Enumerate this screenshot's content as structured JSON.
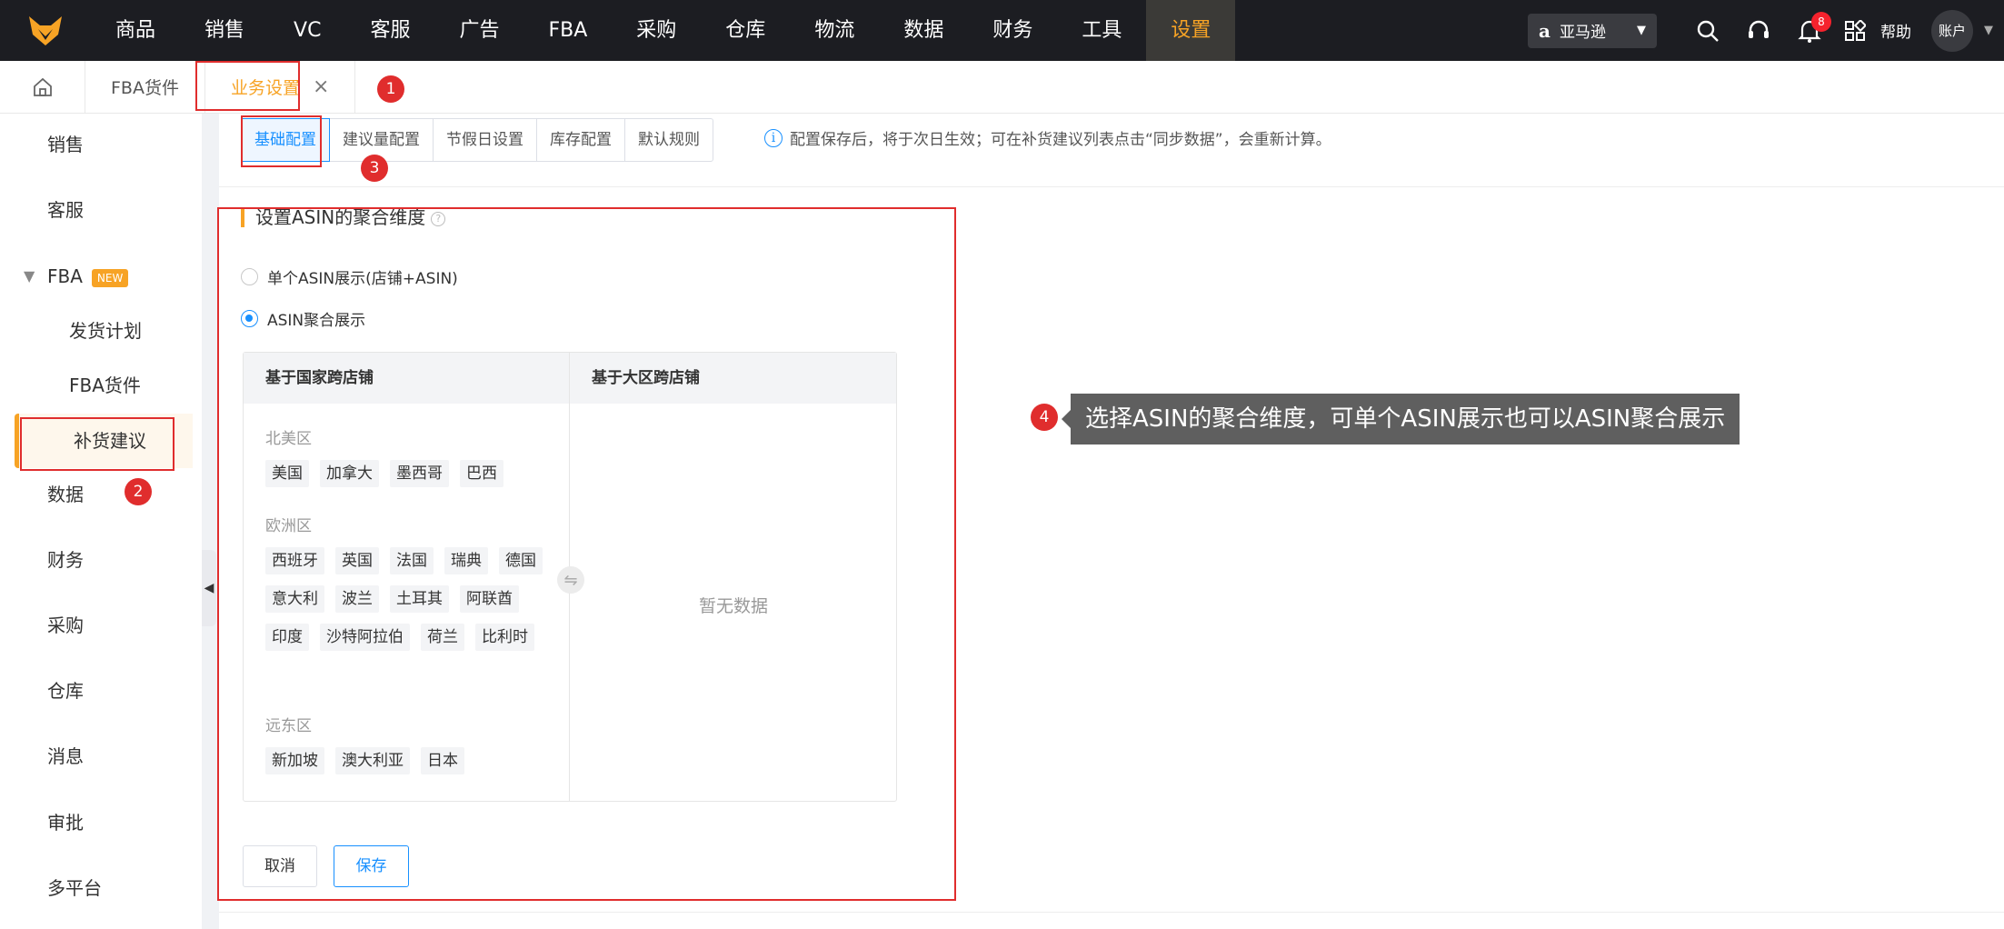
{
  "topnav": {
    "items": [
      "商品",
      "销售",
      "VC",
      "客服",
      "广告",
      "FBA",
      "采购",
      "仓库",
      "物流",
      "数据",
      "财务",
      "工具",
      "设置"
    ],
    "active_index": 12,
    "marketplace": "亚马逊",
    "notification_count": "8",
    "help": "帮助",
    "account": "账户"
  },
  "tabs": [
    {
      "label": "FBA货件"
    },
    {
      "label": "业务设置",
      "close": "×"
    }
  ],
  "sidebar": {
    "items": [
      "销售",
      "客服",
      "FBA",
      "发货计划",
      "FBA货件",
      "补货建议",
      "数据",
      "财务",
      "采购",
      "仓库",
      "消息",
      "审批",
      "多平台"
    ],
    "new_badge": "NEW"
  },
  "subtabs": [
    "基础配置",
    "建议量配置",
    "节假日设置",
    "库存配置",
    "默认规则"
  ],
  "info_note": "配置保存后，将于次日生效；可在补货建议列表点击“同步数据”，会重新计算。",
  "section": {
    "title": "设置ASIN的聚合维度",
    "radio_single": "单个ASIN展示(店铺+ASIN)",
    "radio_aggregate": "ASIN聚合展示",
    "selected": "ASIN聚合展示"
  },
  "transfer": {
    "left_title": "基于国家跨店铺",
    "right_title": "基于大区跨店铺",
    "regions": [
      {
        "name": "北美区",
        "countries": [
          "美国",
          "加拿大",
          "墨西哥",
          "巴西"
        ]
      },
      {
        "name": "欧洲区",
        "countries": [
          "西班牙",
          "英国",
          "法国",
          "瑞典",
          "德国",
          "意大利",
          "波兰",
          "土耳其",
          "阿联酋",
          "印度",
          "沙特阿拉伯",
          "荷兰",
          "比利时"
        ]
      },
      {
        "name": "远东区",
        "countries": [
          "新加坡",
          "澳大利亚",
          "日本"
        ]
      }
    ],
    "empty": "暂无数据"
  },
  "buttons": {
    "cancel": "取消",
    "save": "保存"
  },
  "annotations": {
    "b1": "1",
    "b2": "2",
    "b3": "3",
    "b4": "4",
    "tooltip": "选择ASIN的聚合维度，可单个ASIN展示也可以ASIN聚合展示"
  },
  "colors": {
    "accent": "#f7a325",
    "primary": "#1890ff",
    "annotation": "#e02d2d"
  }
}
